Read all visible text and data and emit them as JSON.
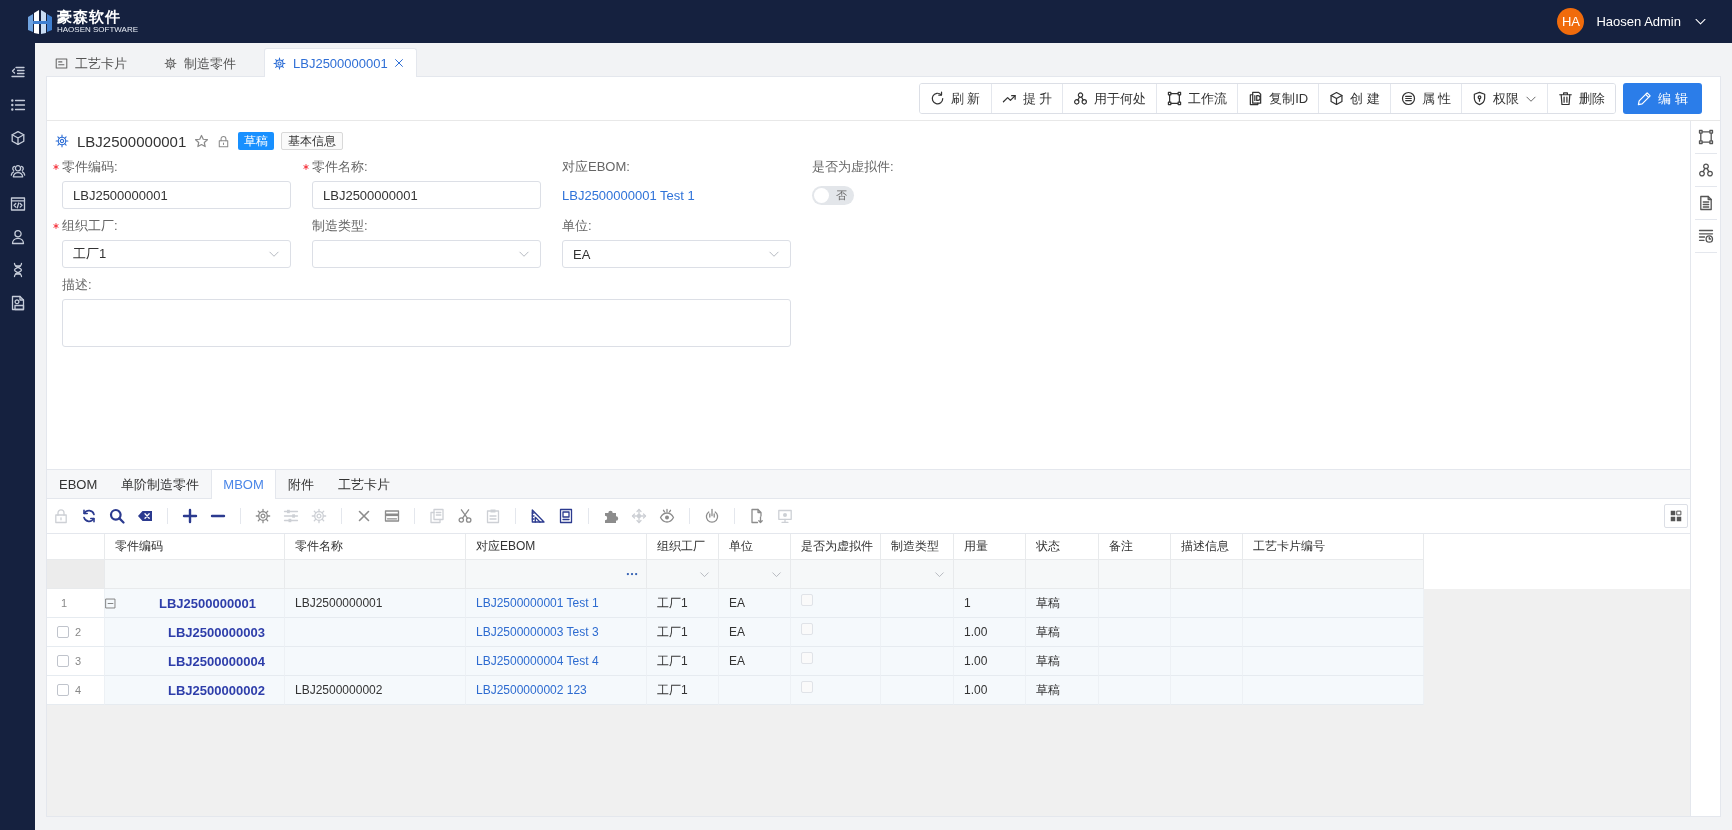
{
  "header": {
    "logo": {
      "title": "豪森软件",
      "subtitle": "HAOSEN SOFTWARE"
    },
    "user": {
      "initials": "HA",
      "name": "Haosen Admin"
    }
  },
  "page_tabs": [
    {
      "label": "工艺卡片",
      "selected": false,
      "closable": false
    },
    {
      "label": "制造零件",
      "selected": false,
      "closable": false
    },
    {
      "label": "LBJ2500000001",
      "selected": true,
      "closable": true
    }
  ],
  "toolbar": {
    "buttons": [
      {
        "label": "刷 新",
        "dropdown": false
      },
      {
        "label": "提 升",
        "dropdown": false
      },
      {
        "label": "用于何处",
        "dropdown": false
      },
      {
        "label": "工作流",
        "dropdown": false
      },
      {
        "label": "复制ID",
        "dropdown": false
      },
      {
        "label": "创 建",
        "dropdown": false
      },
      {
        "label": "属 性",
        "dropdown": false
      },
      {
        "label": "权限",
        "dropdown": true
      },
      {
        "label": "删除",
        "dropdown": false
      }
    ],
    "primary": {
      "label": "编 辑"
    }
  },
  "record": {
    "title": "LBJ2500000001",
    "status": "草稿",
    "tag": "基本信息"
  },
  "fields": [
    {
      "label": "零件编码:",
      "required": true,
      "kind": "input",
      "value": "LBJ2500000001"
    },
    {
      "label": "零件名称:",
      "required": true,
      "kind": "input",
      "value": "LBJ2500000001"
    },
    {
      "label": "对应EBOM:",
      "required": false,
      "kind": "link",
      "value": "LBJ2500000001 Test 1"
    },
    {
      "label": "是否为虚拟件:",
      "required": false,
      "kind": "switch",
      "on": false,
      "disabled": true,
      "text": "否"
    },
    {
      "label": "组织工厂:",
      "required": true,
      "kind": "select",
      "value": "工厂1"
    },
    {
      "label": "制造类型:",
      "required": false,
      "kind": "select"
    },
    {
      "label": "单位:",
      "required": false,
      "kind": "select",
      "value": "EA"
    },
    {
      "label": "描述:",
      "required": false,
      "kind": "textarea"
    }
  ],
  "panel_tabs": [
    {
      "label": "EBOM",
      "selected": false
    },
    {
      "label": "单阶制造零件",
      "selected": false
    },
    {
      "label": "MBOM",
      "selected": true
    },
    {
      "label": "附件",
      "selected": false
    },
    {
      "label": "工艺卡片",
      "selected": false
    }
  ],
  "grid_toolbar": {
    "groups": [
      [
        {
          "disabled": true
        },
        {
          "disabled": false
        },
        {
          "disabled": false
        },
        {
          "disabled": false
        }
      ],
      [
        {
          "disabled": false
        },
        {
          "disabled": false
        }
      ],
      [
        {
          "disabled": false
        },
        {
          "disabled": true
        },
        {
          "disabled": true
        }
      ],
      [
        {
          "disabled": false
        },
        {
          "disabled": false
        }
      ],
      [
        {
          "disabled": true
        },
        {
          "disabled": false
        },
        {
          "disabled": true
        }
      ],
      [
        {
          "disabled": false
        },
        {
          "disabled": false
        }
      ],
      [
        {
          "disabled": false
        },
        {
          "disabled": true
        },
        {
          "disabled": false
        }
      ],
      [
        {
          "disabled": false
        }
      ],
      [
        {
          "disabled": false
        },
        {
          "disabled": true
        }
      ]
    ]
  },
  "grid": {
    "columns": [
      {
        "label": "零件编码",
        "kind": "text"
      },
      {
        "label": "零件名称",
        "kind": "text"
      },
      {
        "label": "对应EBOM",
        "kind": "lookup"
      },
      {
        "label": "组织工厂",
        "kind": "select"
      },
      {
        "label": "单位",
        "kind": "select"
      },
      {
        "label": "是否为虚拟件",
        "kind": "text"
      },
      {
        "label": "制造类型",
        "kind": "select"
      },
      {
        "label": "用量",
        "kind": "text"
      },
      {
        "label": "状态",
        "kind": "text"
      },
      {
        "label": "备注",
        "kind": "text"
      },
      {
        "label": "描述信息",
        "kind": "text"
      },
      {
        "label": "工艺卡片编号",
        "kind": "text"
      }
    ],
    "rows": [
      {
        "index": "1",
        "expanded": true,
        "code": "LBJ2500000001",
        "name": "LBJ2500000001",
        "ebom": "LBJ2500000001 Test 1",
        "plant": "工厂1",
        "unit": "EA",
        "virtual": false,
        "qty": "1",
        "status": "草稿",
        "children": [
          {
            "index": "2",
            "checked": false,
            "code": "LBJ2500000003",
            "ebom": "LBJ2500000003 Test 3",
            "plant": "工厂1",
            "unit": "EA",
            "virtual": false,
            "qty": "1.00",
            "status": "草稿"
          },
          {
            "index": "3",
            "checked": false,
            "code": "LBJ2500000004",
            "ebom": "LBJ2500000004 Test 4",
            "plant": "工厂1",
            "unit": "EA",
            "virtual": false,
            "qty": "1.00",
            "status": "草稿"
          },
          {
            "index": "4",
            "checked": false,
            "code": "LBJ2500000002",
            "name": "LBJ2500000002",
            "ebom": "LBJ2500000002 123",
            "plant": "工厂1",
            "virtual": false,
            "qty": "1.00",
            "status": "草稿"
          }
        ]
      }
    ]
  }
}
